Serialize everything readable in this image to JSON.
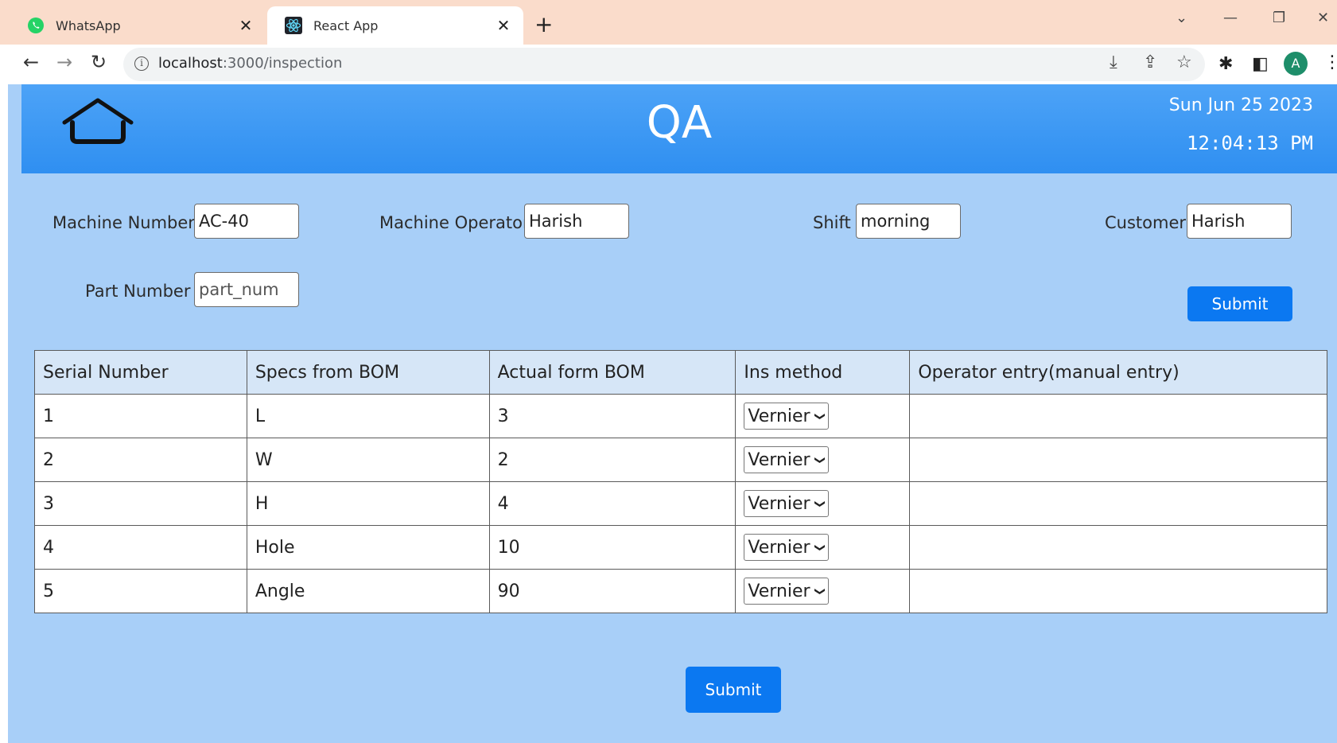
{
  "browser": {
    "tabs": [
      {
        "title": "WhatsApp",
        "icon": "whatsapp-icon",
        "active": false
      },
      {
        "title": "React App",
        "icon": "react-icon",
        "active": true
      }
    ],
    "address": {
      "host": "localhost",
      "path": ":3000/inspection"
    },
    "profile_initial": "A"
  },
  "header": {
    "title": "QA",
    "date": "Sun Jun 25 2023",
    "time": "12:04:13 PM"
  },
  "form": {
    "machine_number": {
      "label": "Machine Number",
      "value": "AC-40"
    },
    "machine_operator": {
      "label": "Machine Operator",
      "value": "Harish"
    },
    "shift": {
      "label": "Shift",
      "value": "morning"
    },
    "customer": {
      "label": "Customer",
      "value": "Harish"
    },
    "part_number": {
      "label": "Part Number",
      "placeholder": "part_num"
    },
    "submit_label": "Submit"
  },
  "table": {
    "headers": [
      "Serial Number",
      "Specs from BOM",
      "Actual form BOM",
      "Ins method",
      "Operator entry(manual entry)"
    ],
    "rows": [
      {
        "serial": "1",
        "spec": "L",
        "actual": "3",
        "method": "Vernier",
        "entry": ""
      },
      {
        "serial": "2",
        "spec": "W",
        "actual": "2",
        "method": "Vernier",
        "entry": ""
      },
      {
        "serial": "3",
        "spec": "H",
        "actual": "4",
        "method": "Vernier",
        "entry": ""
      },
      {
        "serial": "4",
        "spec": "Hole",
        "actual": "10",
        "method": "Vernier",
        "entry": ""
      },
      {
        "serial": "5",
        "spec": "Angle",
        "actual": "90",
        "method": "Vernier",
        "entry": ""
      }
    ]
  },
  "bottom_submit_label": "Submit",
  "colors": {
    "header": "#3596f3",
    "page": "#a8cff8",
    "button": "#0b78f1",
    "tabbar": "#fadccb"
  }
}
